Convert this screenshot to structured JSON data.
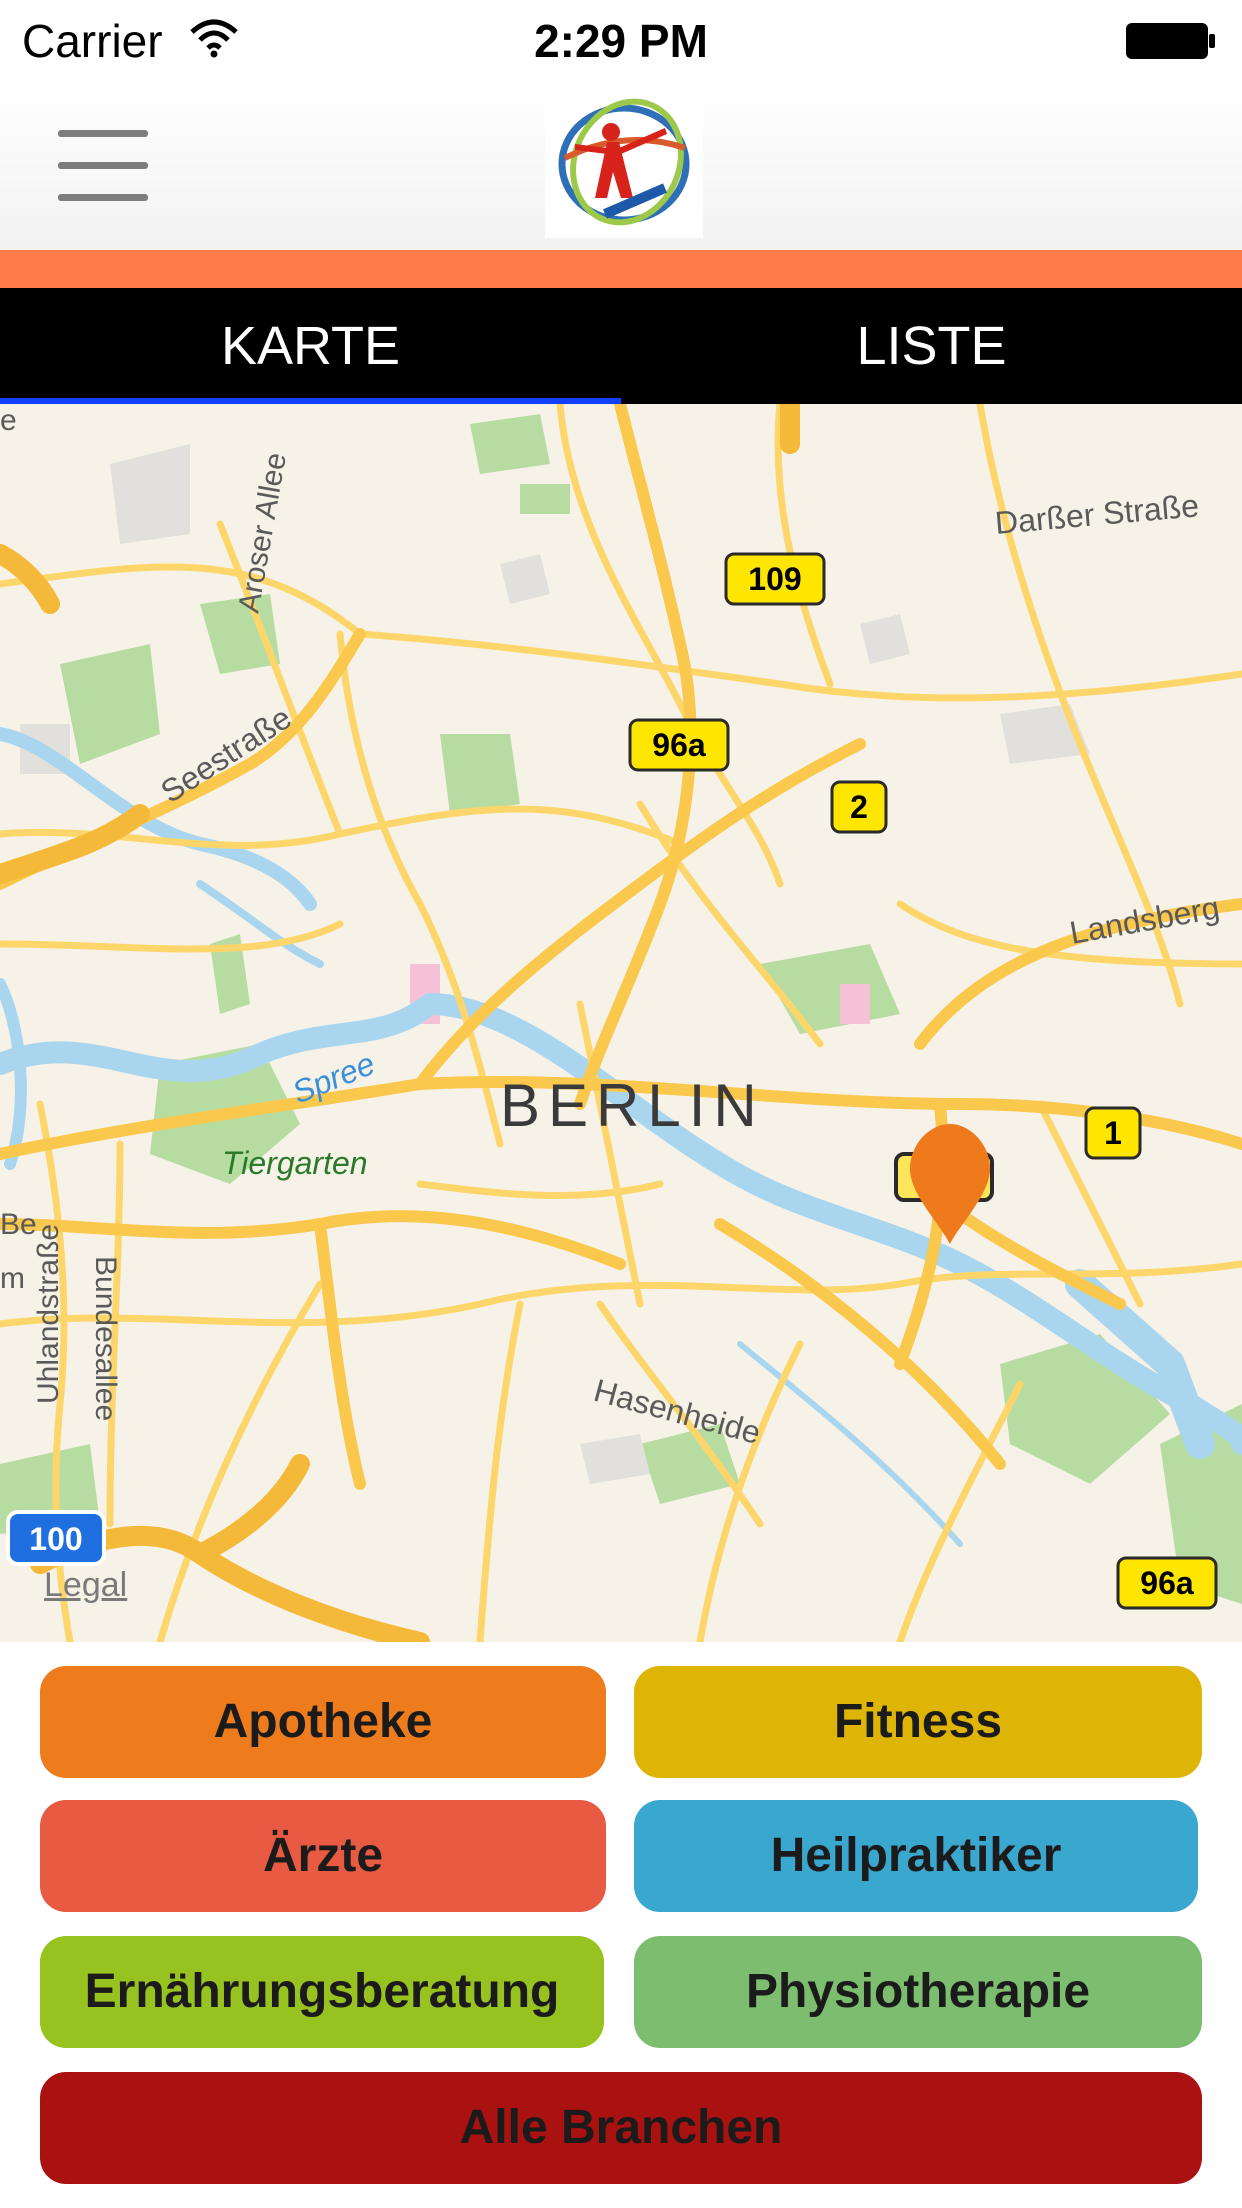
{
  "status_bar": {
    "carrier": "Carrier",
    "time": "2:29 PM"
  },
  "tabs": {
    "map_label": "KARTE",
    "list_label": "LISTE",
    "active": "map"
  },
  "map": {
    "city_label": "BERLIN",
    "legal_label": "Legal",
    "street_labels": {
      "darsser": "Darßer Straße",
      "aroser": "Aroser Allee",
      "seestrasse": "Seestraße",
      "landsberg": "Landsberg",
      "spree": "Spree",
      "tiergarten": "Tiergarten",
      "uhland": "Uhlandstraße",
      "bundes": "Bundesallee",
      "hasenheide": "Hasenheide",
      "edge_e": "e",
      "edge_be": "Be",
      "edge_m": "m"
    },
    "route_shields": {
      "r109": "109",
      "r96a_north": "96a",
      "r2": "2",
      "r1": "1",
      "r96a_south": "96a",
      "a100": "100"
    },
    "colors": {
      "land": "#f7f2e8",
      "road": "#fdd66b",
      "highway": "#f5b93a",
      "water": "#a9d6ee",
      "park": "#b7dca2",
      "pin": "#ef7a1c"
    }
  },
  "categories": {
    "apotheke": {
      "label": "Apotheke",
      "color": "#ee7c1c"
    },
    "fitness": {
      "label": "Fitness",
      "color": "#dfb505"
    },
    "aerzte": {
      "label": "Ärzte",
      "color": "#e85a42"
    },
    "heilpraktiker": {
      "label": "Heilpraktiker",
      "color": "#3aa7cf"
    },
    "ernaehrung": {
      "label": "Ernährungsberatung",
      "color": "#98c21f"
    },
    "physio": {
      "label": "Physiotherapie",
      "color": "#7dbd6f"
    },
    "alle": {
      "label": "Alle Branchen",
      "color": "#aa1111"
    }
  }
}
